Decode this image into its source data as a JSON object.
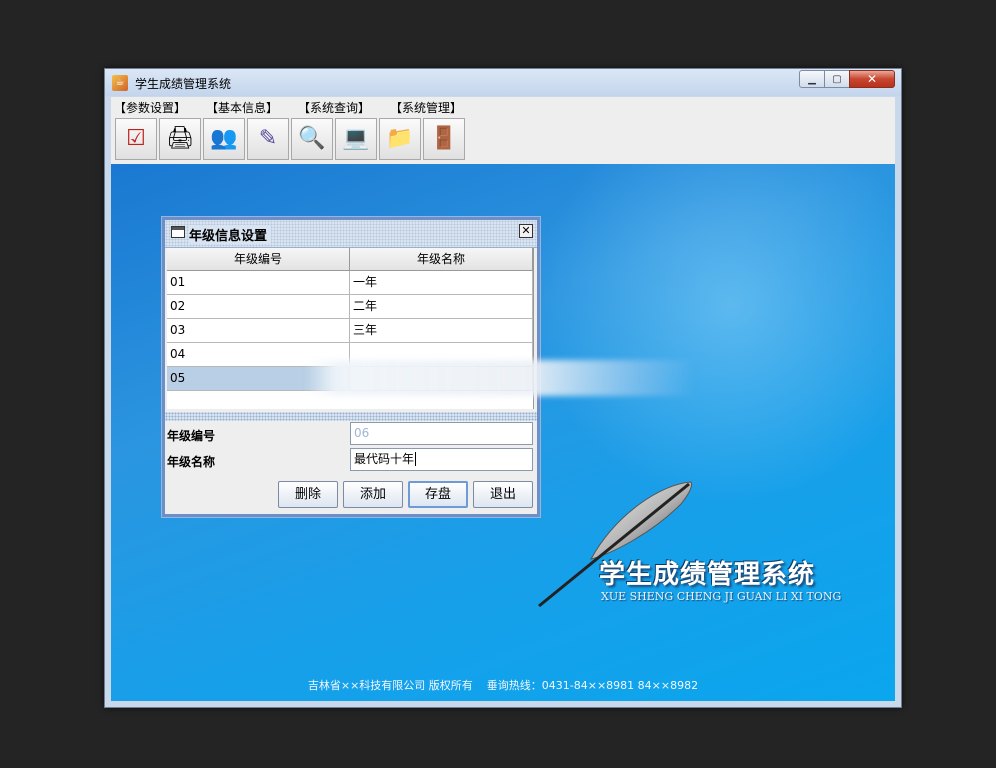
{
  "window": {
    "title": "学生成绩管理系统"
  },
  "menu": {
    "items": [
      "【参数设置】",
      "【基本信息】",
      "【系统查询】",
      "【系统管理】"
    ]
  },
  "toolbar": {
    "buttons": [
      {
        "icon": "checklist-icon",
        "glyph": "☑"
      },
      {
        "icon": "printer-icon",
        "glyph": "🖨"
      },
      {
        "icon": "people-icon",
        "glyph": "👥"
      },
      {
        "icon": "edit-tools-icon",
        "glyph": "✎"
      },
      {
        "icon": "magnifier-icon",
        "glyph": "🔍"
      },
      {
        "icon": "computer-icon",
        "glyph": "💻"
      },
      {
        "icon": "folder-computer-icon",
        "glyph": "📁"
      },
      {
        "icon": "exit-icon",
        "glyph": "🚪"
      }
    ]
  },
  "dialog": {
    "title": "年级信息设置",
    "columns": [
      "年级编号",
      "年级名称"
    ],
    "rows": [
      {
        "code": "01",
        "name": "一年"
      },
      {
        "code": "02",
        "name": "二年"
      },
      {
        "code": "03",
        "name": "三年"
      },
      {
        "code": "04",
        "name": ""
      },
      {
        "code": "05",
        "name": "",
        "selected": true
      }
    ],
    "form": {
      "code_label": "年级编号",
      "code_value": "06",
      "name_label": "年级名称",
      "name_value": "最代码十年"
    },
    "buttons": {
      "delete": "删除",
      "add": "添加",
      "save": "存盘",
      "exit": "退出"
    }
  },
  "logo": {
    "title": "学生成绩管理系统",
    "subtitle": "XUE SHENG CHENG JI GUAN LI XI TONG"
  },
  "footer": {
    "text": "吉林省××科技有限公司 版权所有    垂询热线：0431-84××8981 84××8982"
  },
  "colors": {
    "desktop": "#1a9ae6",
    "dialog_border": "#6b8fc8",
    "selection": "#b8cfe5"
  }
}
